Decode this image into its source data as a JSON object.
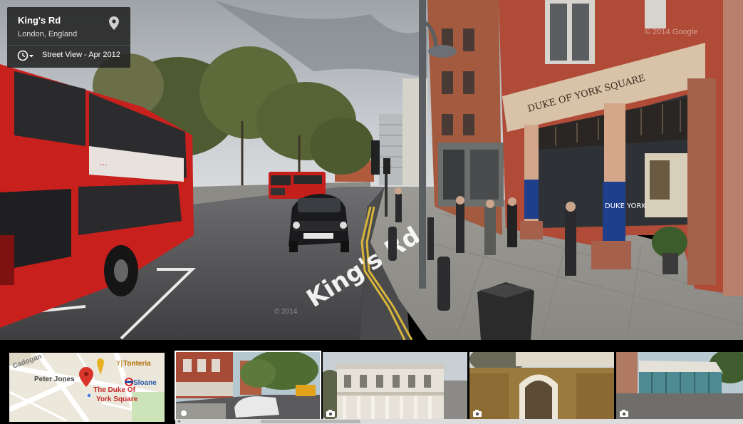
{
  "info_card": {
    "title": "King's Rd",
    "subtitle": "London, England",
    "capture_date": "Street View - Apr 2012"
  },
  "scene": {
    "road_marking": "King's Rd",
    "building_sign": "DUKE OF YORK SQUARE",
    "pillar_banner": "DUKE YORK",
    "bus_ad": "...",
    "watermark": "© 2014 Google",
    "road_watermark": "© 2014"
  },
  "minimap": {
    "label_peter_jones": "Peter Jones",
    "label_tonteria": "Tonteria",
    "label_sloane": "Sloane",
    "label_cadogan": "Cadogan",
    "label_dest_line1": "The Duke Of",
    "label_dest_line2": "York Square"
  },
  "thumbnails": [
    {
      "name": "street"
    },
    {
      "name": "building"
    },
    {
      "name": "archway"
    },
    {
      "name": "pavilion"
    }
  ],
  "colors": {
    "bus_red": "#c8201c",
    "pin_red": "#d9352b",
    "banner_blue": "#1f3f8c",
    "card_bg": "#222222"
  },
  "icons": {
    "pin": "pin-icon",
    "history": "clock-icon",
    "camera": "camera-icon"
  }
}
